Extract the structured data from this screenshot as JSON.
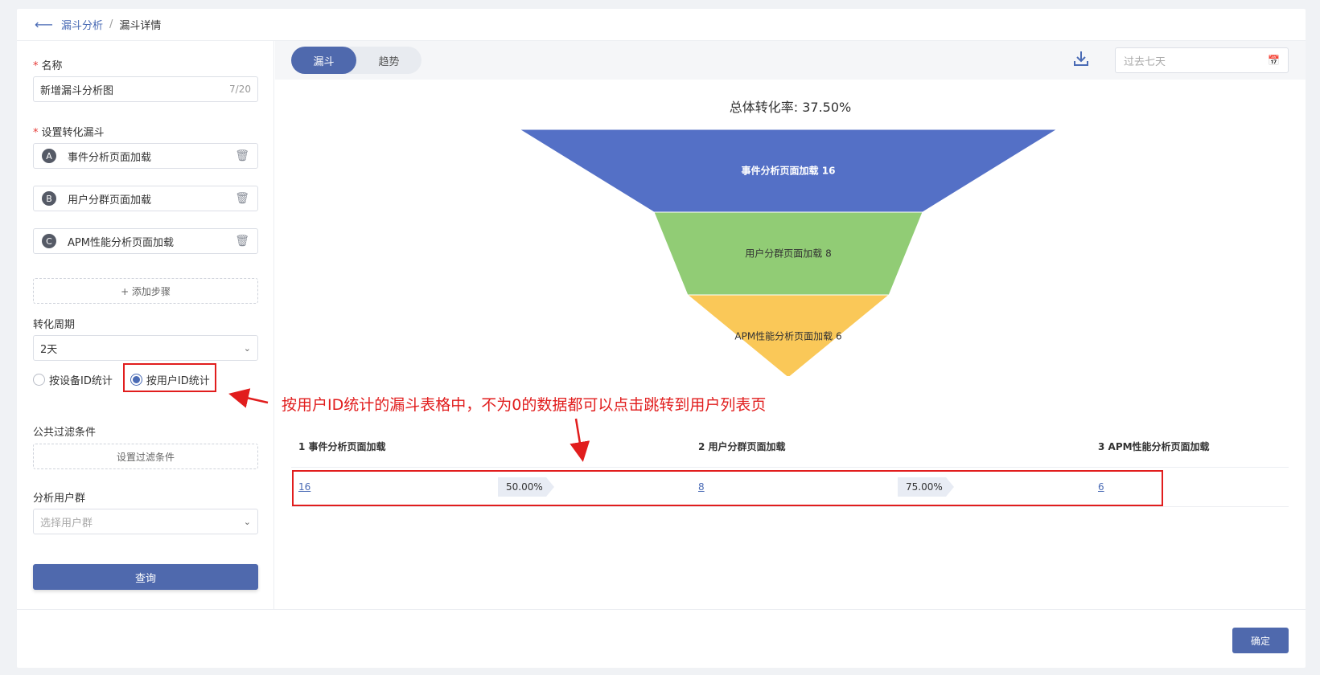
{
  "breadcrumb": {
    "back_icon": "arrow-left-icon",
    "parent": "漏斗分析",
    "separator": "/",
    "current": "漏斗详情"
  },
  "form": {
    "name_label": "名称",
    "name_value": "新增漏斗分析图",
    "name_count": "7/20",
    "funnel_label": "设置转化漏斗",
    "steps": [
      {
        "badge": "A",
        "label": "事件分析页面加载"
      },
      {
        "badge": "B",
        "label": "用户分群页面加载"
      },
      {
        "badge": "C",
        "label": "APM性能分析页面加载"
      }
    ],
    "add_step": "+ 添加步骤",
    "period_label": "转化周期",
    "period_value": "2天",
    "radio_device": "按设备ID统计",
    "radio_user": "按用户ID统计",
    "filter_label": "公共过滤条件",
    "filter_button": "设置过滤条件",
    "group_label": "分析用户群",
    "group_placeholder": "选择用户群",
    "query_button": "查询"
  },
  "toolbar": {
    "tabs": [
      "漏斗",
      "趋势"
    ],
    "active_tab": "漏斗",
    "download_icon": "download-icon",
    "date_placeholder": "过去七天",
    "calendar_icon": "calendar-icon"
  },
  "chart_data": {
    "type": "funnel",
    "title": "总体转化率: 37.50%",
    "stages": [
      {
        "label": "事件分析页面加载 16",
        "name": "事件分析页面加载",
        "value": 16,
        "color": "#5470c6"
      },
      {
        "label": "用户分群页面加载 8",
        "name": "用户分群页面加载",
        "value": 8,
        "color": "#91cc75"
      },
      {
        "label": "APM性能分析页面加载 6",
        "name": "APM性能分析页面加载",
        "value": 6,
        "color": "#fac858"
      }
    ]
  },
  "annotation": "按用户ID统计的漏斗表格中，不为0的数据都可以点击跳转到用户列表页",
  "table": {
    "headers": [
      "1 事件分析页面加载",
      "2 用户分群页面加载",
      "3 APM性能分析页面加载"
    ],
    "values": [
      "16",
      "8",
      "6"
    ],
    "rates": [
      "50.00%",
      "75.00%"
    ]
  },
  "footer": {
    "ok_button": "确定"
  }
}
